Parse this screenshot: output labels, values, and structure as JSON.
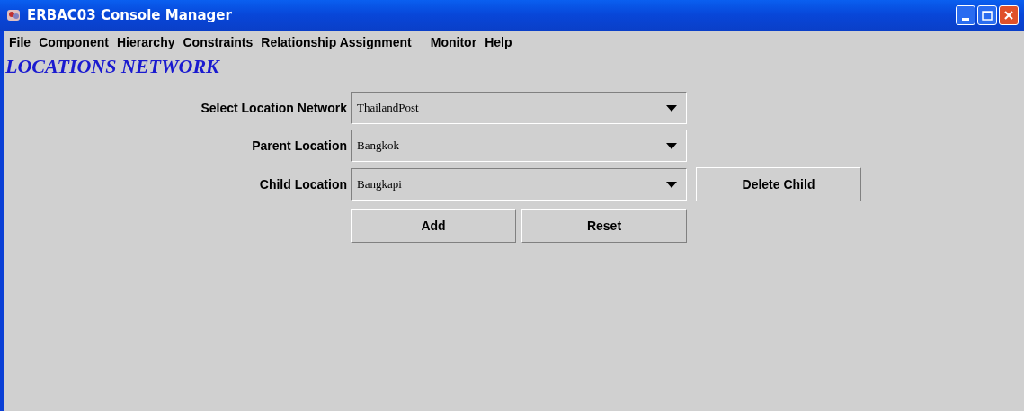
{
  "window": {
    "title": "ERBAC03 Console Manager"
  },
  "menu": [
    "File",
    "Component",
    "Hierarchy",
    "Constraints",
    "Relationship Assignment",
    "Monitor",
    "Help"
  ],
  "heading": "LOCATIONS NETWORK",
  "fields": [
    {
      "label": "Select Location Network",
      "value": "ThailandPost"
    },
    {
      "label": "Parent Location",
      "value": "Bangkok"
    },
    {
      "label": "Child Location",
      "value": "Bangkapi",
      "action": "Delete Child"
    }
  ],
  "buttons": [
    "Add",
    "Reset"
  ]
}
